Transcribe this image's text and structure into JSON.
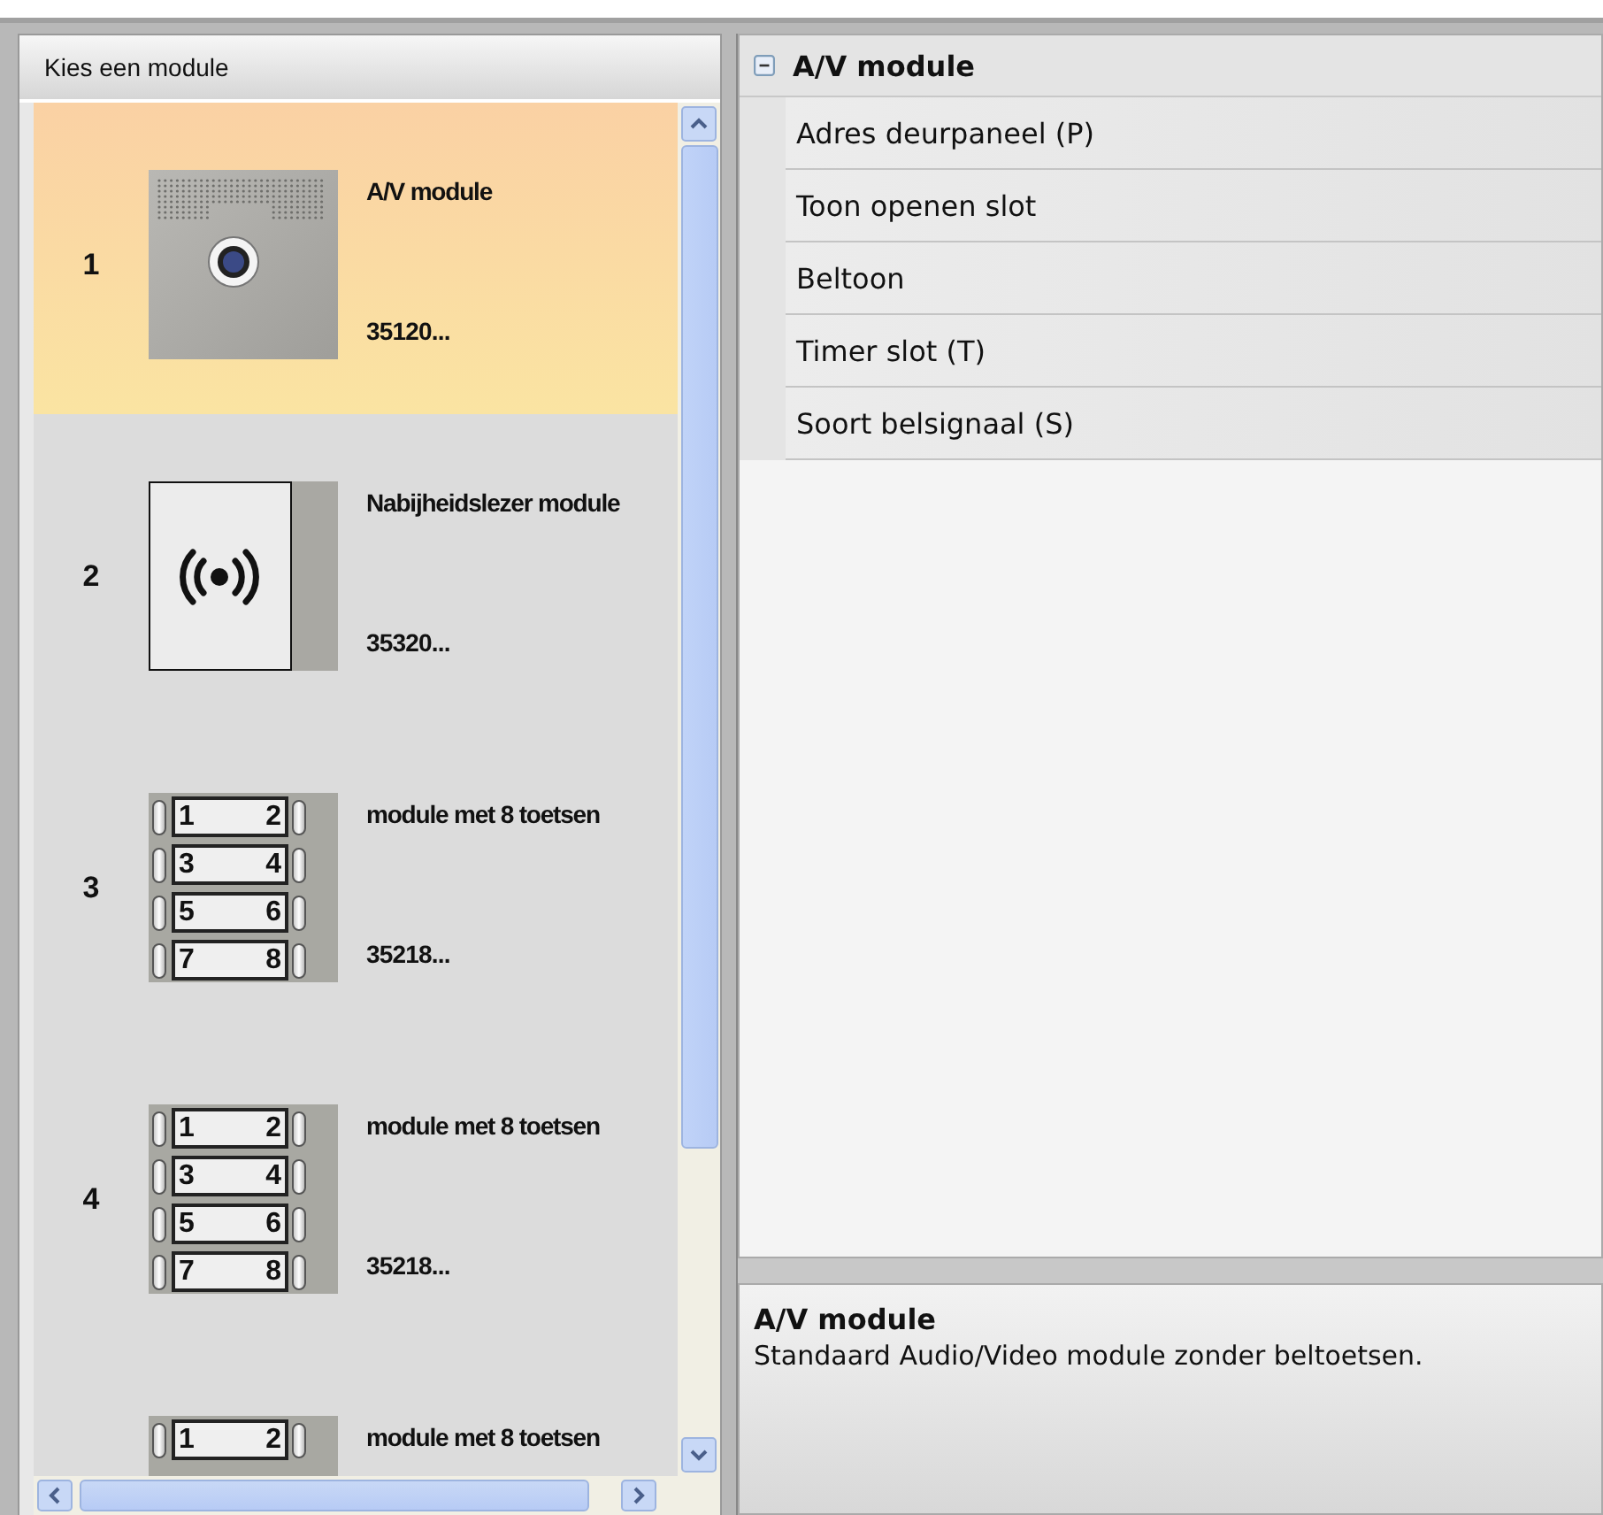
{
  "module_panel": {
    "title": "Kies een module",
    "items": [
      {
        "number": "1",
        "kind": "camera",
        "title": "A/V module",
        "code": "35120...",
        "selected": true
      },
      {
        "number": "2",
        "kind": "proximity",
        "title": "Nabijheidslezer module",
        "code": "35320...",
        "selected": false
      },
      {
        "number": "3",
        "kind": "keypad",
        "keys": [
          "1",
          "2",
          "3",
          "4",
          "5",
          "6",
          "7",
          "8"
        ],
        "title": "module met 8 toetsen",
        "code": "35218...",
        "selected": false
      },
      {
        "number": "4",
        "kind": "keypad",
        "keys": [
          "1",
          "2",
          "3",
          "4",
          "5",
          "6",
          "7",
          "8"
        ],
        "title": "module met 8 toetsen",
        "code": "35218...",
        "selected": false
      },
      {
        "kind": "keypad",
        "keys": [
          "1",
          "2"
        ],
        "title": "module met 8 toetsen",
        "selected": false
      }
    ]
  },
  "properties": {
    "category": "A/V module",
    "expanded": true,
    "rows": [
      "Adres deurpaneel (P)",
      "Toon openen slot",
      "Beltoon",
      "Timer slot (T)",
      "Soort belsignaal (S)"
    ]
  },
  "description": {
    "title": "A/V module",
    "text": "Standaard Audio/Video module zonder beltoetsen."
  }
}
